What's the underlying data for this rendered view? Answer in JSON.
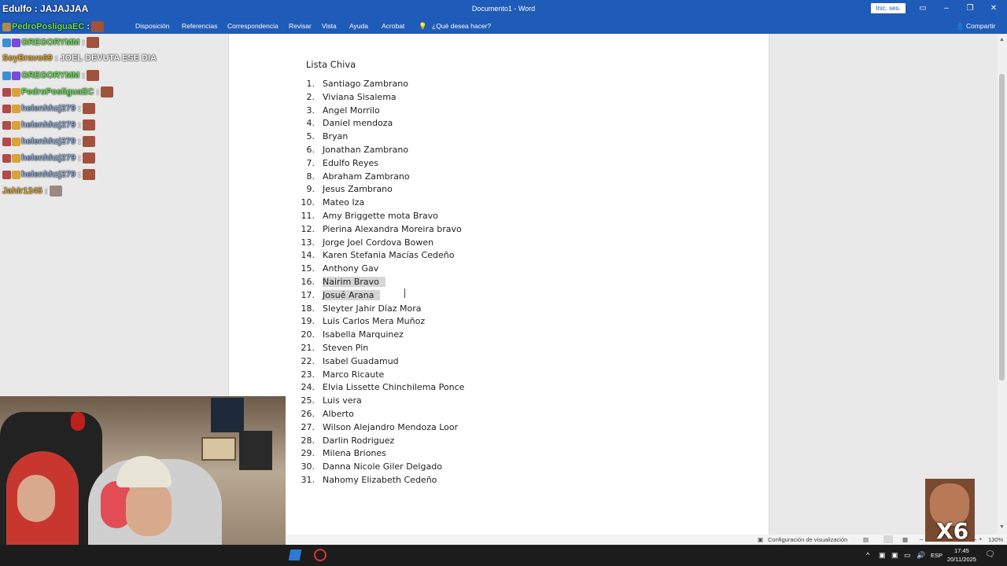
{
  "window": {
    "title": "Documento1  -  Word",
    "signin_label": "Inic. ses."
  },
  "ribbon": {
    "tabs": [
      "Disposición",
      "Referencias",
      "Correspondencia",
      "Revisar",
      "Vista",
      "Ayuda",
      "Acrobat"
    ],
    "tell_me": "¿Qué desea hacer?",
    "share": "Compartir"
  },
  "chat_overlay": {
    "top_message": "Edulfo : JAJAJJAA",
    "lines": [
      {
        "user": "PedroPosliguaEC",
        "color": "#6ee05a",
        "text": ":"
      },
      {
        "user": "GREGORYMM",
        "color": "#6ee05a",
        "text": ":"
      },
      {
        "user": "SoyBravo69",
        "color": "#e0a93a",
        "text": ": JOEL DEVUTA ESE DIA"
      },
      {
        "user": "GREGORYMM",
        "color": "#6ee05a",
        "text": ":"
      },
      {
        "user": "PedroPosliguaEC",
        "color": "#6ee05a",
        "text": ":"
      },
      {
        "user": "helenhhzj279",
        "color": "#8aa8d8",
        "text": ":"
      },
      {
        "user": "helenhhzj279",
        "color": "#8aa8d8",
        "text": ":"
      },
      {
        "user": "helenhhzj279",
        "color": "#8aa8d8",
        "text": ":"
      },
      {
        "user": "helenhhzj279",
        "color": "#8aa8d8",
        "text": ":"
      },
      {
        "user": "helenhhzj279",
        "color": "#8aa8d8",
        "text": ":"
      },
      {
        "user": "Jahir1245",
        "color": "#e0a93a",
        "text": ":"
      }
    ]
  },
  "document": {
    "heading": "Lista Chiva",
    "items": [
      {
        "n": "1.",
        "text": "Santiago Zambrano",
        "selected": false
      },
      {
        "n": "2.",
        "text": "Viviana Sisalema",
        "selected": false
      },
      {
        "n": "3.",
        "text": "Angel Morrilo",
        "selected": false
      },
      {
        "n": "4.",
        "text": "Daniel mendoza",
        "selected": false
      },
      {
        "n": "5.",
        "text": "Bryan",
        "selected": false
      },
      {
        "n": "6.",
        "text": "Jonathan Zambrano",
        "selected": false
      },
      {
        "n": "7.",
        "text": "Edulfo Reyes",
        "selected": false
      },
      {
        "n": "8.",
        "text": "Abraham Zambrano",
        "selected": false
      },
      {
        "n": "9.",
        "text": "Jesus Zambrano",
        "selected": false
      },
      {
        "n": "10.",
        "text": "Mateo Iza",
        "selected": false
      },
      {
        "n": "11.",
        "text": "Amy Briggette mota Bravo",
        "selected": false
      },
      {
        "n": "12.",
        "text": "Pierina Alexandra Moreira bravo",
        "selected": false
      },
      {
        "n": "13.",
        "text": "Jorge Joel Cordova Bowen",
        "selected": false
      },
      {
        "n": "14.",
        "text": "Karen Stefania Macías Cedeño",
        "selected": false
      },
      {
        "n": "15.",
        "text": "Anthony Gav",
        "selected": false
      },
      {
        "n": "16.",
        "text": "Nairim Bravo",
        "selected": true
      },
      {
        "n": "17.",
        "text": "Josué Arana",
        "selected": true
      },
      {
        "n": "18.",
        "text": "Sleyter Jahir Díaz Mora",
        "selected": false
      },
      {
        "n": "19.",
        "text": "Luis Carlos Mera Muñoz",
        "selected": false
      },
      {
        "n": "20.",
        "text": "Isabella Marquinez",
        "selected": false
      },
      {
        "n": "21.",
        "text": "Steven Pin",
        "selected": false
      },
      {
        "n": "22.",
        "text": "Isabel Guadamud",
        "selected": false
      },
      {
        "n": "23.",
        "text": "Marco Ricaute",
        "selected": false
      },
      {
        "n": "24.",
        "text": "Elvia Lissette Chinchilema Ponce",
        "selected": false
      },
      {
        "n": "25.",
        "text": "Luis vera",
        "selected": false
      },
      {
        "n": "26.",
        "text": "Alberto",
        "selected": false
      },
      {
        "n": "27.",
        "text": "Wilson Alejandro Mendoza Loor",
        "selected": false
      },
      {
        "n": "28.",
        "text": "Darlin Rodriguez",
        "selected": false
      },
      {
        "n": "29.",
        "text": "Milena Briones",
        "selected": false
      },
      {
        "n": "30.",
        "text": "Danna Nicole Giler Delgado",
        "selected": false
      },
      {
        "n": "31.",
        "text": "Nahomy Elizabeth Cedeño",
        "selected": false
      }
    ]
  },
  "statusbar": {
    "display_settings": "Configuración de visualización",
    "zoom": "130%"
  },
  "taskbar": {
    "language": "ESP",
    "time": "17:45",
    "date": "20/11/2025"
  },
  "overlay": {
    "multiplier": "X6"
  }
}
